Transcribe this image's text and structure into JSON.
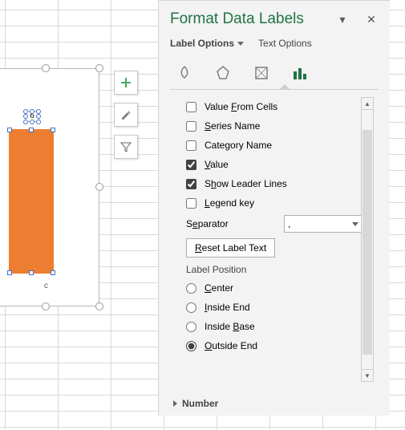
{
  "chart_data": {
    "type": "bar",
    "categories": [
      "c"
    ],
    "values": [
      6
    ],
    "title": "",
    "xlabel": "",
    "ylabel": "",
    "data_labels": true,
    "label_position": "Outside End"
  },
  "chart": {
    "data_label_value": "6",
    "category_label": "c"
  },
  "side_tools": {
    "add": "+",
    "brush": "brush",
    "filter": "filter"
  },
  "pane": {
    "title": "Format Data Labels",
    "dropdown_glyph": "▾",
    "close_glyph": "✕",
    "tab_label_options": "Label Options",
    "tab_text_options": "Text Options"
  },
  "icon_tabs": {
    "fill_line": "Fill & Line",
    "effects": "Effects",
    "size_props": "Size & Properties",
    "label_options": "Label Options"
  },
  "options": {
    "value_from_cells": {
      "label_pre": "Value ",
      "u": "F",
      "label_post": "rom Cells",
      "checked": false
    },
    "series_name": {
      "u": "S",
      "label_post": "eries Name",
      "checked": false
    },
    "category_name": {
      "label_pre": "Cate",
      "u": "g",
      "label_post": "ory Name",
      "checked": false
    },
    "value": {
      "u": "V",
      "label_post": "alue",
      "checked": true
    },
    "show_leader": {
      "label_pre": "S",
      "u": "h",
      "label_post": "ow Leader Lines",
      "checked": true
    },
    "legend_key": {
      "u": "L",
      "label_post": "egend key",
      "checked": false
    },
    "separator_label_pre": "S",
    "separator_u": "e",
    "separator_label_post": "parator",
    "separator_value": ",",
    "reset_btn_u": "R",
    "reset_btn_post": "eset Label Text",
    "position_section": "Label Position",
    "pos": {
      "center": {
        "u": "C",
        "post": "enter",
        "sel": false
      },
      "inside_end": {
        "u": "I",
        "post": "nside End",
        "sel": false
      },
      "inside_base": {
        "pre": "Inside ",
        "u": "B",
        "post": "ase",
        "sel": false
      },
      "outside_end": {
        "u": "O",
        "post": "utside End",
        "sel": true
      }
    },
    "number_section": "Number"
  }
}
